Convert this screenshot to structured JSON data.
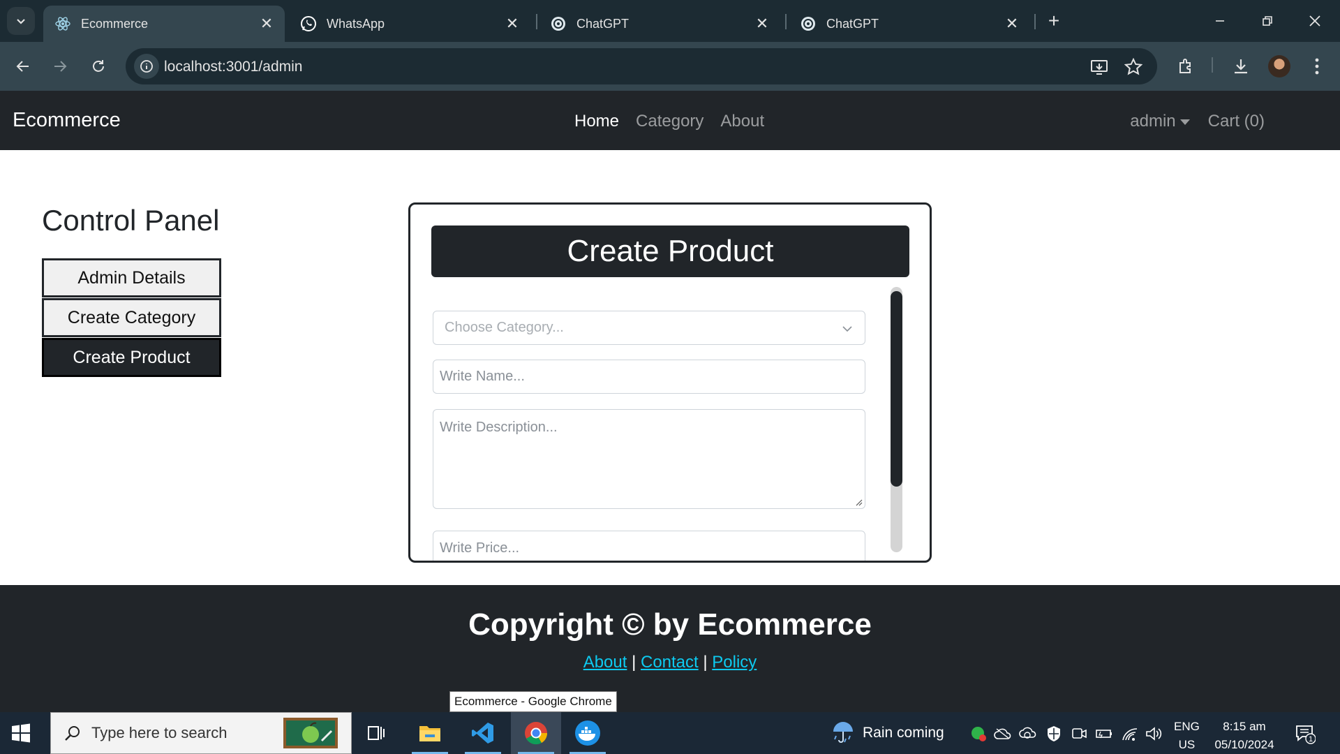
{
  "browser": {
    "tabs": [
      {
        "title": "Ecommerce",
        "active": true,
        "icon": "react-icon"
      },
      {
        "title": "WhatsApp",
        "active": false,
        "icon": "whatsapp-icon"
      },
      {
        "title": "ChatGPT",
        "active": false,
        "icon": "chatgpt-icon"
      },
      {
        "title": "ChatGPT",
        "active": false,
        "icon": "chatgpt-icon"
      }
    ],
    "url": "localhost:3001/admin"
  },
  "navbar": {
    "brand": "Ecommerce",
    "links": [
      "Home",
      "Category",
      "About"
    ],
    "user": "admin",
    "cart": "Cart (0)"
  },
  "sidebar": {
    "title": "Control Panel",
    "buttons": [
      "Admin Details",
      "Create Category",
      "Create Product"
    ]
  },
  "form": {
    "title": "Create Product",
    "category_placeholder": "Choose Category...",
    "name_placeholder": "Write Name...",
    "description_placeholder": "Write Description...",
    "price_placeholder": "Write Price..."
  },
  "footer": {
    "copyright": "Copyright © by Ecommerce",
    "links": [
      "About",
      "Contact",
      "Policy"
    ],
    "separator": "|"
  },
  "tooltip": "Ecommerce - Google Chrome",
  "taskbar": {
    "search_placeholder": "Type here to search",
    "weather": "Rain coming",
    "lang_top": "ENG",
    "lang_bottom": "US",
    "time": "8:15 am",
    "date": "05/10/2024",
    "notification_count": "1"
  },
  "colors": {
    "navbar_bg": "#212529",
    "link_accent": "#0dcaf0",
    "chrome_dark": "#1c2b33",
    "chrome_toolbar": "#34464f"
  }
}
